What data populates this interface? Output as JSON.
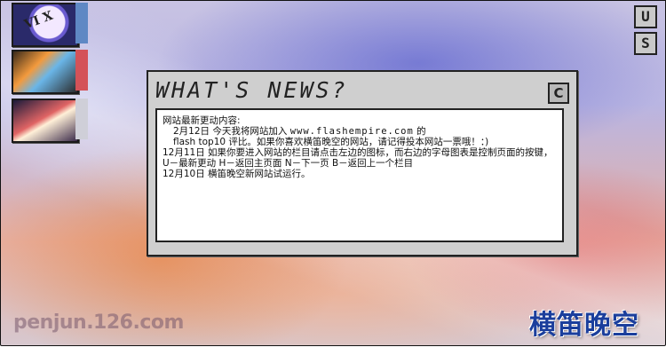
{
  "left_thumbnails": [
    "thumb-clock",
    "thumb-keyboard",
    "thumb-disk"
  ],
  "thumb1_glyphs": "VI X",
  "side_buttons": {
    "u": "U",
    "s": "S"
  },
  "news": {
    "title": "WHAT'S NEWS?",
    "close_label": "C",
    "heading": "网站最新更动内容:",
    "line1_prefix": "2月12日 今天我将网站加入 ",
    "line1_url": "www.flashempire.com",
    "line1_suffix": " 的",
    "line2": "flash top10 评比。如果你喜欢横笛晚空的网站，请记得投本网站一票哦！：)",
    "line3": "12月11日 如果你要进入网站的栏目请点击左边的图标，而右边的字母图表是控制页面的按键，U－最新更动 H－返回主页面 N－下一页 B－返回上一个栏目",
    "line4": "12月10日 横笛晚空新网站试运行。"
  },
  "footer": {
    "url": "penjun.126.com",
    "logo": "横笛晚空"
  }
}
